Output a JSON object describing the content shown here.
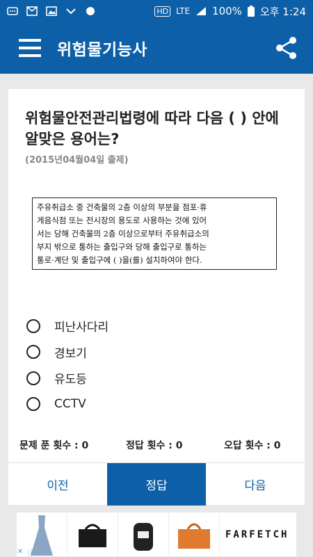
{
  "status_bar": {
    "hd": "HD",
    "network": "LTE",
    "battery": "100%",
    "time": "오후 1:24"
  },
  "app": {
    "title": "위험물기능사"
  },
  "question": {
    "title": "위험물안전관리법령에 따라 다음 ( ) 안에 알맞은 용어는?",
    "date": "(2015년04월04일 출제)",
    "box_lines": [
      "주유취급소 중 건축물의 2층 이상의 부분을 점포·휴",
      "게음식점 또는 전시장의 용도로 사용하는 것에 있어",
      "서는 당해 건축물의 2층 이상으로부터 주유취급소의",
      "부지 밖으로 통하는 출입구와 당해 출입구로 통하는",
      "통로·계단 및 출입구에 (    )을(를) 설치하여야 한다."
    ]
  },
  "options": [
    "피난사다리",
    "경보기",
    "유도등",
    "CCTV"
  ],
  "counts": {
    "solved": "문제 푼 횟수 : 0",
    "correct": "정답 횟수 : 0",
    "wrong": "오답 횟수 : 0"
  },
  "buttons": {
    "prev": "이전",
    "answer": "정답",
    "next": "다음"
  },
  "ad": {
    "brand": "FARFETCH"
  },
  "colors": {
    "primary": "#0d5fa8"
  }
}
